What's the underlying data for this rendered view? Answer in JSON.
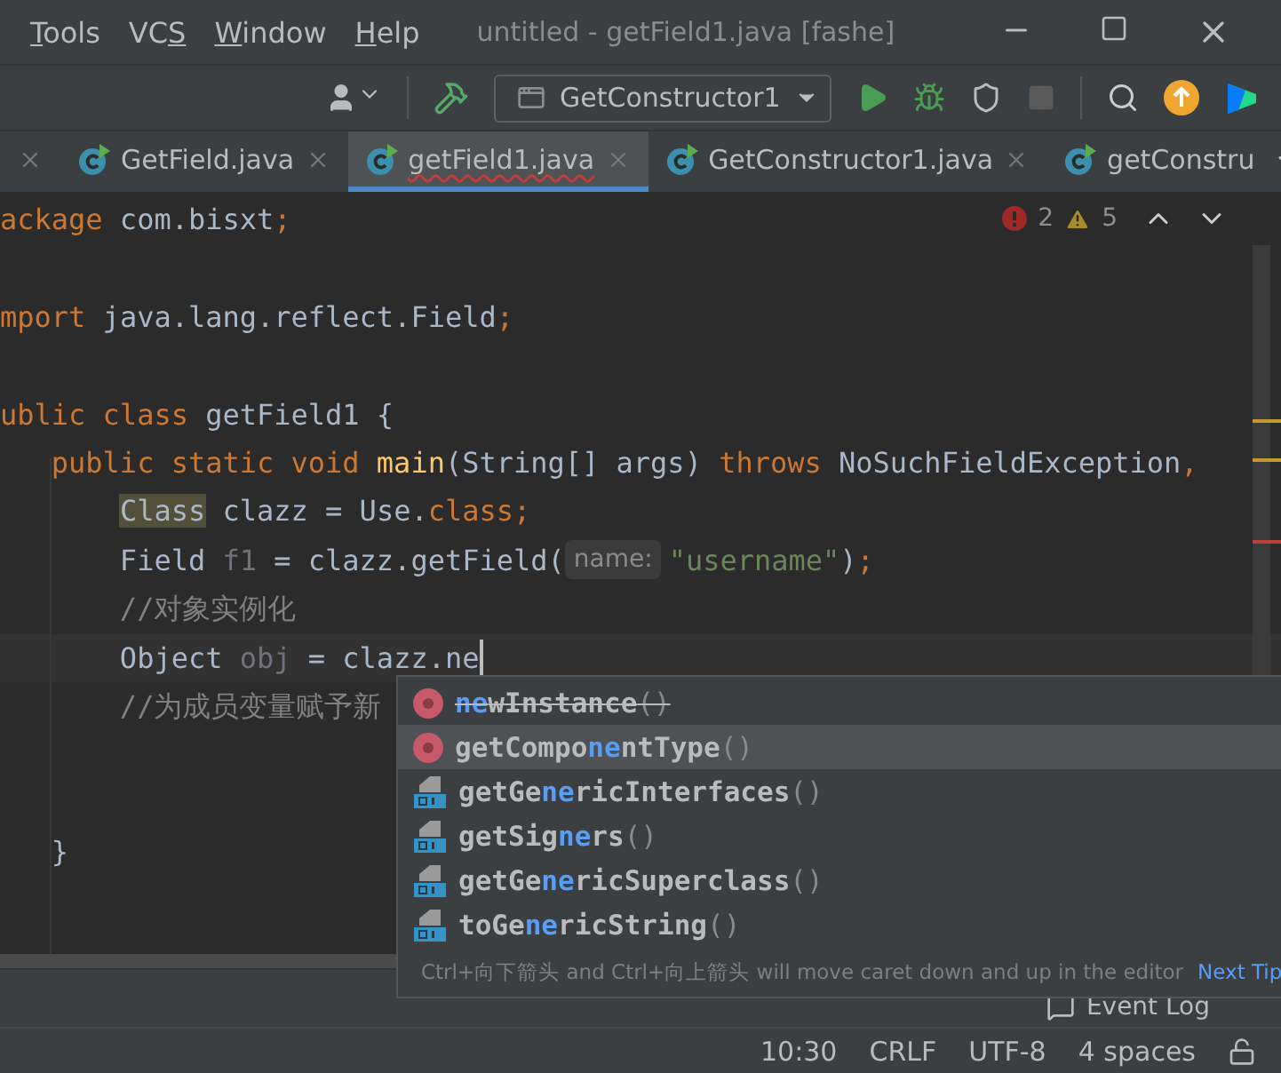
{
  "menu": [
    {
      "key": "T",
      "after": "ools"
    },
    {
      "before": "VC",
      "key": "S"
    },
    {
      "key": "W",
      "after": "indow"
    },
    {
      "key": "H",
      "after": "elp"
    }
  ],
  "window": {
    "title": "untitled - getField1.java [fashe]"
  },
  "toolbar": {
    "run_config": "GetConstructor1",
    "stop_disabled": true
  },
  "tabs": [
    {
      "label": "GetField.java",
      "selected": false,
      "closable": true,
      "error": false
    },
    {
      "label": "getField1.java",
      "selected": true,
      "closable": true,
      "error": true
    },
    {
      "label": "GetConstructor1.java",
      "selected": false,
      "closable": true,
      "error": false
    },
    {
      "label": "getConstru",
      "selected": false,
      "closable": false,
      "error": false
    }
  ],
  "inspections": {
    "errors": "2",
    "warnings": "5"
  },
  "code_lines": [
    {
      "kind": "code",
      "tokens": [
        {
          "kind": "keyword",
          "s": "ackage"
        },
        {
          "kind": "plain",
          "s": " com.bisxt"
        },
        {
          "kind": "keyword",
          "s": ";"
        }
      ]
    },
    {
      "kind": "blank"
    },
    {
      "kind": "code",
      "tokens": [
        {
          "kind": "keyword",
          "s": "mport"
        },
        {
          "kind": "plain",
          "s": " java.lang.reflect.Field"
        },
        {
          "kind": "keyword",
          "s": ";"
        }
      ]
    },
    {
      "kind": "blank"
    },
    {
      "kind": "code",
      "tokens": [
        {
          "kind": "keyword",
          "s": "ublic class "
        },
        {
          "kind": "plain",
          "s": "getField1 {"
        }
      ]
    },
    {
      "kind": "code",
      "tokens": [
        {
          "kind": "keyword",
          "s": "   public static void "
        },
        {
          "kind": "function",
          "s": "main"
        },
        {
          "kind": "plain",
          "s": "(String[] args) "
        },
        {
          "kind": "keyword",
          "s": "throws "
        },
        {
          "kind": "plain",
          "s": "NoSuchFieldException"
        },
        {
          "kind": "keyword",
          "s": ","
        }
      ]
    },
    {
      "kind": "code",
      "tokens": [
        {
          "kind": "highlight",
          "s": "       Class"
        },
        {
          "kind": "plain",
          "s": " clazz = Use."
        },
        {
          "kind": "keyword",
          "s": "class;"
        }
      ]
    },
    {
      "kind": "code",
      "tokens": [
        {
          "kind": "plain",
          "s": "       Field "
        },
        {
          "kind": "unused",
          "s": "f1"
        },
        {
          "kind": "plain",
          "s": " = clazz.getField("
        },
        {
          "kind": "hint",
          "s": "name:"
        },
        {
          "kind": "string",
          "s": "\"username\""
        },
        {
          "kind": "plain",
          "s": ")"
        },
        {
          "kind": "keyword",
          "s": ";"
        }
      ]
    },
    {
      "kind": "code",
      "tokens": [
        {
          "kind": "comment",
          "s": "       //对象实例化"
        }
      ]
    },
    {
      "kind": "code",
      "caret": true,
      "tokens": [
        {
          "kind": "plain",
          "s": "       Object "
        },
        {
          "kind": "unused",
          "s": "obj"
        },
        {
          "kind": "plain",
          "s": " = clazz.ne"
        }
      ]
    },
    {
      "kind": "code",
      "tokens": [
        {
          "kind": "comment",
          "s": "       //为成员变量赋予新"
        }
      ]
    },
    {
      "kind": "blank"
    },
    {
      "kind": "blank"
    },
    {
      "kind": "code",
      "tokens": [
        {
          "kind": "plain",
          "s": "   }"
        }
      ]
    }
  ],
  "completion": {
    "items": [
      {
        "kind": "method",
        "match": "ne",
        "suffix": "wInstance",
        "parens": "()",
        "deprecated": true,
        "selected": false
      },
      {
        "kind": "method",
        "prefix": "getCompo",
        "match": "ne",
        "suffix": "ntType",
        "parens": "()",
        "deprecated": false,
        "selected": true
      },
      {
        "kind": "native",
        "prefix": "getGe",
        "match": "ne",
        "suffix": "ricInterfaces",
        "parens": "()",
        "deprecated": false,
        "selected": false
      },
      {
        "kind": "native",
        "prefix": "getSig",
        "match": "ne",
        "suffix": "rs",
        "parens": "()",
        "deprecated": false,
        "selected": false
      },
      {
        "kind": "native",
        "prefix": "getGe",
        "match": "ne",
        "suffix": "ricSuperclass",
        "parens": "()",
        "deprecated": false,
        "selected": false
      },
      {
        "kind": "native",
        "prefix": "toGe",
        "match": "ne",
        "suffix": "ricString",
        "parens": "()",
        "deprecated": false,
        "selected": false
      }
    ],
    "hint": "Ctrl+向下箭头 and Ctrl+向上箭头 will move caret down and up in the editor",
    "next_tip": "Next Tip"
  },
  "event_log": "Event Log",
  "status_bar": [
    "10:30",
    "CRLF",
    "UTF-8",
    "4 spaces"
  ]
}
